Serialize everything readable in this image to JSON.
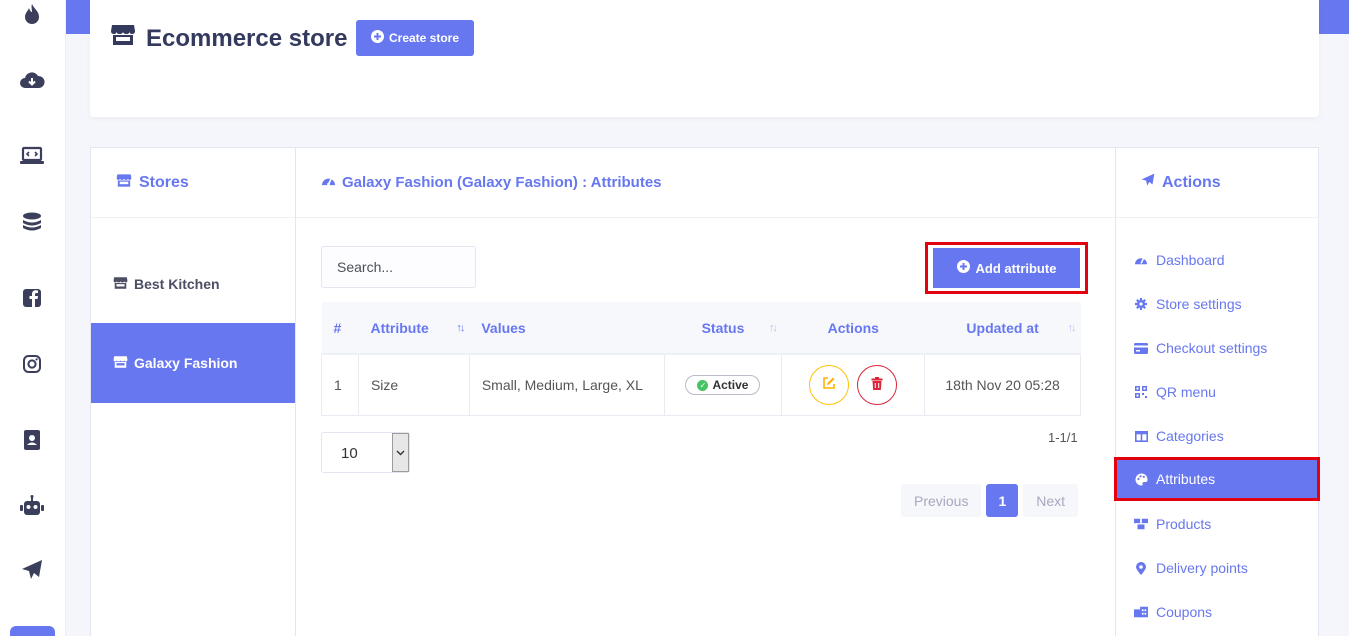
{
  "header": {
    "title": "Ecommerce store",
    "create_label": "Create store"
  },
  "stores": {
    "heading": "Stores",
    "items": [
      {
        "label": "Best Kitchen",
        "active": false
      },
      {
        "label": "Galaxy Fashion",
        "active": true
      }
    ]
  },
  "center": {
    "heading": "Galaxy Fashion (Galaxy Fashion) : Attributes",
    "search_placeholder": "Search...",
    "add_label": "Add attribute",
    "columns": [
      "#",
      "Attribute",
      "Values",
      "Status",
      "Actions",
      "Updated at"
    ],
    "rows": [
      {
        "num": "1",
        "attribute": "Size",
        "values": "Small, Medium, Large, XL",
        "status": "Active",
        "updated": "18th Nov 20 05:28"
      }
    ],
    "per_page": "10",
    "count_text": "1-1/1",
    "pagination": {
      "prev": "Previous",
      "current": "1",
      "next": "Next"
    }
  },
  "actions": {
    "heading": "Actions",
    "items": [
      {
        "label": "Dashboard",
        "icon": "tachometer-icon"
      },
      {
        "label": "Store settings",
        "icon": "gear-icon"
      },
      {
        "label": "Checkout settings",
        "icon": "credit-card-icon"
      },
      {
        "label": "QR menu",
        "icon": "qrcode-icon"
      },
      {
        "label": "Categories",
        "icon": "columns-icon"
      },
      {
        "label": "Attributes",
        "icon": "palette-icon",
        "active": true
      },
      {
        "label": "Products",
        "icon": "boxes-icon"
      },
      {
        "label": "Delivery points",
        "icon": "map-pin-icon"
      },
      {
        "label": "Coupons",
        "icon": "coupon-icon"
      }
    ]
  },
  "colors": {
    "primary": "#6777ef",
    "highlight": "#e3000f",
    "success": "#47c363",
    "warning": "#ffc107",
    "danger": "#d9263a"
  }
}
